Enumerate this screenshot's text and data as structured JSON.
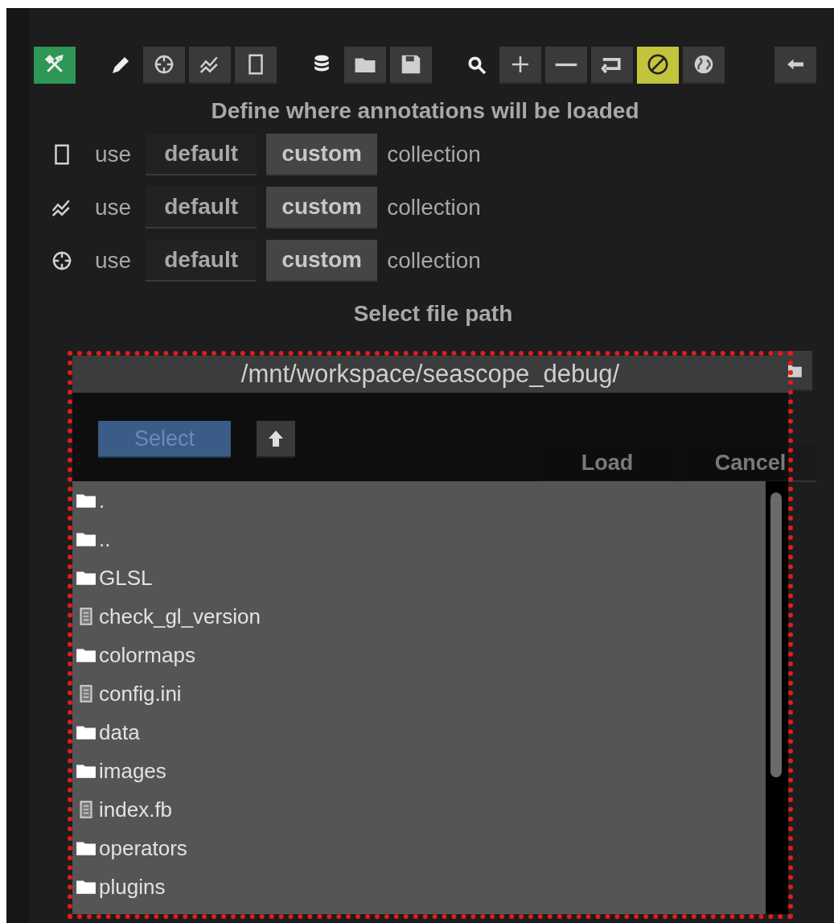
{
  "toolbar": {
    "items": [
      {
        "kind": "button",
        "selected": true,
        "color": "#2e9656"
      },
      {
        "kind": "plain",
        "selected": false
      },
      {
        "kind": "button",
        "selected": false
      },
      {
        "kind": "button",
        "selected": false
      },
      {
        "kind": "button",
        "selected": false
      },
      {
        "kind": "plain",
        "selected": false
      },
      {
        "kind": "button",
        "selected": false
      },
      {
        "kind": "button",
        "selected": false
      },
      {
        "kind": "plain",
        "selected": false
      },
      {
        "kind": "button",
        "selected": false
      },
      {
        "kind": "button",
        "selected": false
      },
      {
        "kind": "button",
        "selected": false
      },
      {
        "kind": "button",
        "selected": true,
        "color": "#c4c43c"
      },
      {
        "kind": "button",
        "selected": false
      },
      {
        "kind": "button",
        "selected": false
      }
    ]
  },
  "heading": "Define where annotations will be loaded",
  "collection_rows": [
    {
      "label": "use",
      "options": [
        {
          "label": "default",
          "selected": false
        },
        {
          "label": "custom",
          "selected": true
        }
      ],
      "suffix": "collection"
    },
    {
      "label": "use",
      "options": [
        {
          "label": "default",
          "selected": false
        },
        {
          "label": "custom",
          "selected": true
        }
      ],
      "suffix": "collection"
    },
    {
      "label": "use",
      "options": [
        {
          "label": "default",
          "selected": false
        },
        {
          "label": "custom",
          "selected": true
        }
      ],
      "suffix": "collection"
    }
  ],
  "file_path_label": "Select file path",
  "actions": [
    "Load",
    "Cancel"
  ],
  "file_dialog": {
    "path": "/mnt/workspace/seascope_debug/",
    "select_button": "Select",
    "entries": [
      {
        "kind": "folder",
        "name": "."
      },
      {
        "kind": "folder",
        "name": ".."
      },
      {
        "kind": "folder",
        "name": "GLSL"
      },
      {
        "kind": "file",
        "name": "check_gl_version"
      },
      {
        "kind": "folder",
        "name": "colormaps"
      },
      {
        "kind": "file",
        "name": "config.ini"
      },
      {
        "kind": "folder",
        "name": "data"
      },
      {
        "kind": "folder",
        "name": "images"
      },
      {
        "kind": "file",
        "name": "index.fb"
      },
      {
        "kind": "folder",
        "name": "operators"
      },
      {
        "kind": "folder",
        "name": "plugins"
      }
    ]
  }
}
